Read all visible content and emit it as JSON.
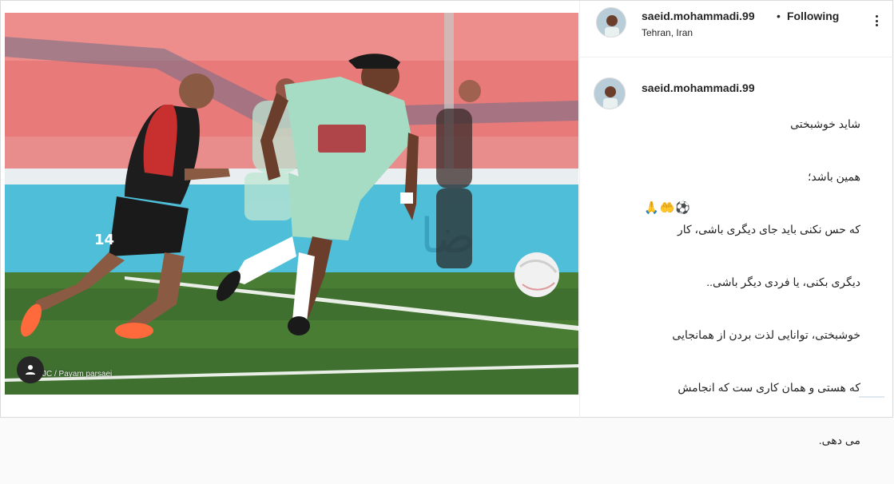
{
  "post": {
    "photo_credit": "JC / Payam parsaei",
    "photo_alt": "football match photo",
    "player_number": "14"
  },
  "header": {
    "username": "saeid.mohammadi.99",
    "separator": "•",
    "follow_status": "Following",
    "location": "Tehran, Iran"
  },
  "caption": {
    "username": "saeid.mohammadi.99",
    "lines": [
      "شاید خوشبختی",
      "همین باشد؛",
      "که حس نکنی باید جای دیگری باشی، کار",
      "دیگری بکنی، یا فردی دیگر باشی..",
      "خوشبختی، توانایی لذت بردن از همانجایی",
      "که هستی و همان کاری ست که انجامش",
      "می دهی."
    ],
    "emojis": "🙏🤲⚽"
  },
  "colors": {
    "accent": "#262626",
    "border": "#dbdbdb",
    "team_red": "#c8302f",
    "team_mint": "#a7dcc4"
  }
}
